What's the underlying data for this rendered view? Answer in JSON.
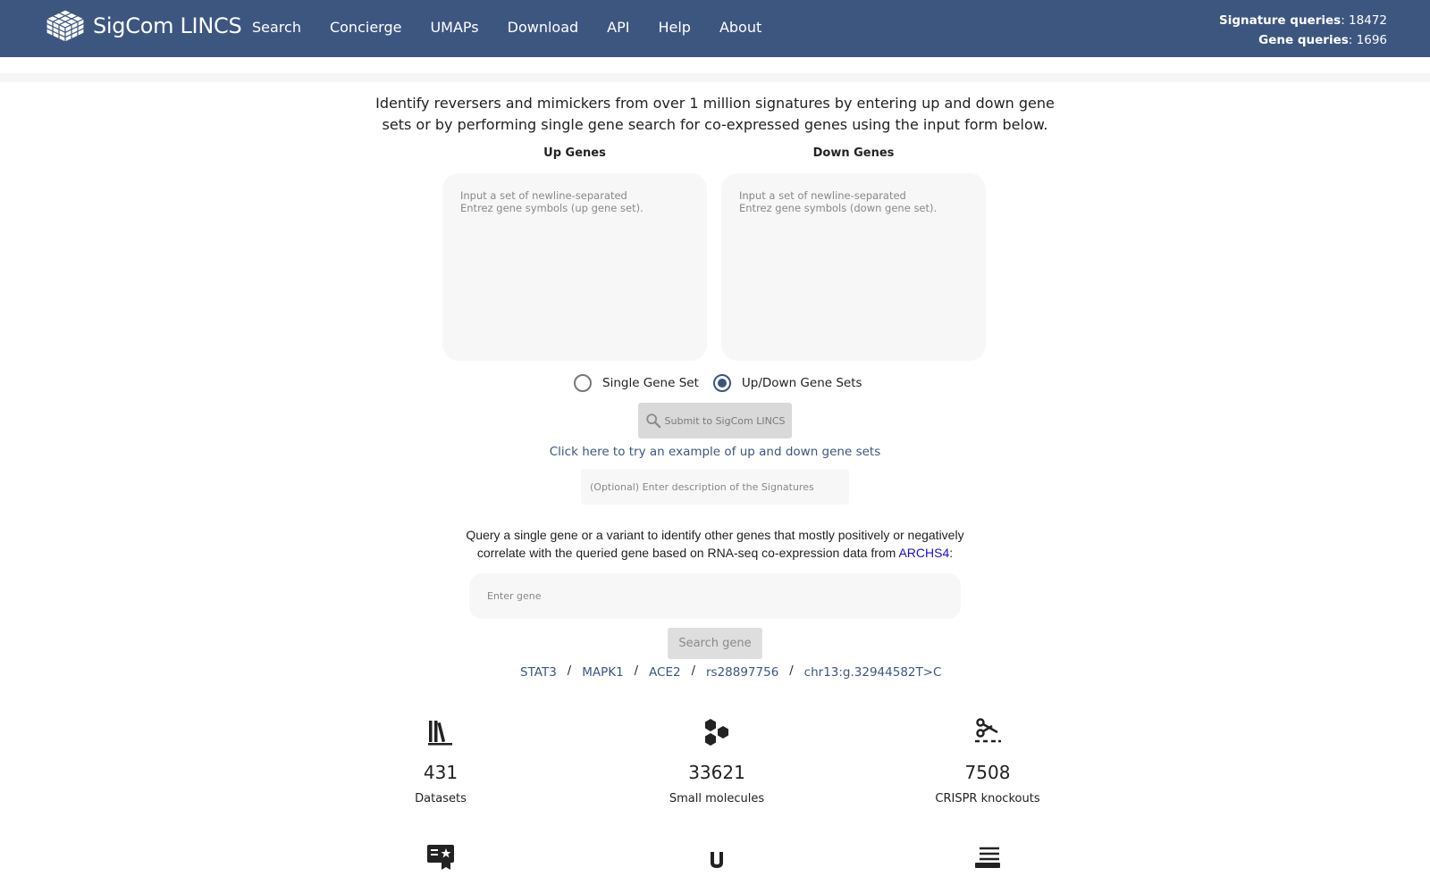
{
  "header": {
    "brand": "SigCom LINCS",
    "nav": [
      "Search",
      "Concierge",
      "UMAPs",
      "Download",
      "API",
      "Help",
      "About"
    ],
    "stats": {
      "signature_label": "Signature queries",
      "signature_value": ": 18472",
      "gene_label": "Gene queries",
      "gene_value": ": 1696"
    }
  },
  "intro": "Identify reversers and mimickers from over 1 million signatures by entering up and down gene sets or by performing single gene search for co-expressed genes using the input form below.",
  "up_genes": {
    "label": "Up Genes",
    "placeholder": "Input a set of newline-separated\nEntrez gene symbols (up gene set)."
  },
  "down_genes": {
    "label": "Down Genes",
    "placeholder": "Input a set of newline-separated\nEntrez gene symbols (down gene set)."
  },
  "mode": {
    "options": [
      "Single Gene Set",
      "Up/Down Gene Sets"
    ],
    "selected": "Up/Down Gene Sets"
  },
  "submit_label": "Submit to SigCom LINCS",
  "example_link": "Click here to try an example of up and down gene sets",
  "description_placeholder": "(Optional) Enter description of the Signatures",
  "gene_query": {
    "text": "Query a single gene or a variant to identify other genes that mostly positively or negatively correlate with the queried gene based on RNA-seq co-expression data from ",
    "link": "ARCHS4",
    "suffix": ":",
    "placeholder": "Enter gene",
    "button": "Search gene",
    "examples": [
      "STAT3",
      "MAPK1",
      "ACE2",
      "rs28897756",
      "chr13:g.32944582T>C"
    ],
    "separator": "/"
  },
  "stats": [
    {
      "icon": "library-books-icon",
      "value": "431",
      "label": "Datasets"
    },
    {
      "icon": "molecule-hexagons-icon",
      "value": "33621",
      "label": "Small molecules"
    },
    {
      "icon": "crispr-scissors-icon",
      "value": "7508",
      "label": "CRISPR knockouts"
    }
  ],
  "colors": {
    "navbar": "#3d5680",
    "link": "#3d5680",
    "archs4_link": "#1a0dd6"
  }
}
